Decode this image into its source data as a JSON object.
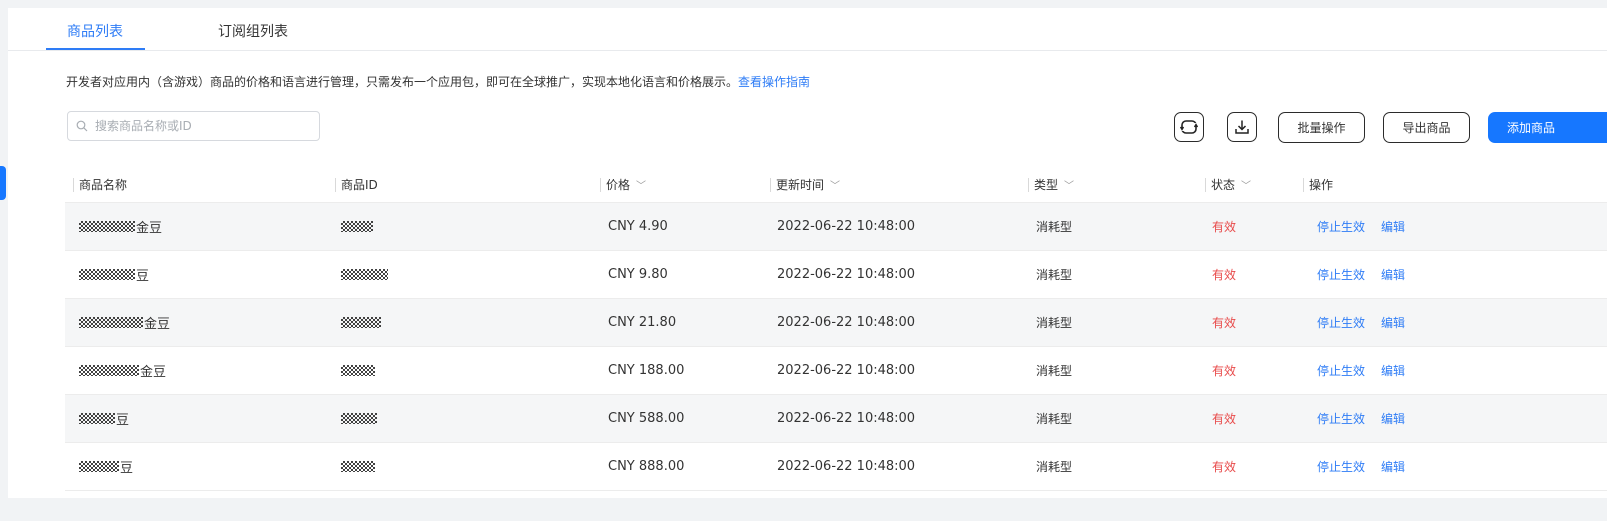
{
  "tabs": [
    {
      "label": "商品列表",
      "active": true
    },
    {
      "label": "订阅组列表",
      "active": false
    }
  ],
  "description": {
    "text": "开发者对应用内（含游戏）商品的价格和语言进行管理，只需发布一个应用包，即可在全球推广，实现本地化语言和价格展示。",
    "link": "查看操作指南"
  },
  "search": {
    "placeholder": "搜索商品名称或ID",
    "value": ""
  },
  "toolbar": {
    "refresh_icon": "refresh-icon",
    "download_icon": "download-icon",
    "batch_label": "批量操作",
    "export_label": "导出商品",
    "add_label": "添加商品"
  },
  "table": {
    "columns": [
      "商品名称",
      "商品ID",
      "价格",
      "更新时间",
      "类型",
      "状态",
      "操作"
    ],
    "sortable": [
      false,
      false,
      true,
      true,
      true,
      true,
      false
    ],
    "rows": [
      {
        "name": "金豆",
        "id": "",
        "price": "CNY 4.90",
        "updated": "2022-06-22 10:48:00",
        "type": "消耗型",
        "status": "有效",
        "actions": [
          "停止生效",
          "编辑"
        ]
      },
      {
        "name": "豆",
        "id": "",
        "price": "CNY 9.80",
        "updated": "2022-06-22 10:48:00",
        "type": "消耗型",
        "status": "有效",
        "actions": [
          "停止生效",
          "编辑"
        ]
      },
      {
        "name": "金豆",
        "id": "",
        "price": "CNY 21.80",
        "updated": "2022-06-22 10:48:00",
        "type": "消耗型",
        "status": "有效",
        "actions": [
          "停止生效",
          "编辑"
        ]
      },
      {
        "name": "金豆",
        "id": "",
        "price": "CNY 188.00",
        "updated": "2022-06-22 10:48:00",
        "type": "消耗型",
        "status": "有效",
        "actions": [
          "停止生效",
          "编辑"
        ]
      },
      {
        "name": "豆",
        "id": "",
        "price": "CNY 588.00",
        "updated": "2022-06-22 10:48:00",
        "type": "消耗型",
        "status": "有效",
        "actions": [
          "停止生效",
          "编辑"
        ]
      },
      {
        "name": "豆",
        "id": "",
        "price": "CNY 888.00",
        "updated": "2022-06-22 10:48:00",
        "type": "消耗型",
        "status": "有效",
        "actions": [
          "停止生效",
          "编辑"
        ]
      }
    ]
  },
  "colors": {
    "accent": "#1677ff",
    "link": "#2e7cf6",
    "status_valid": "#e84a4a"
  }
}
